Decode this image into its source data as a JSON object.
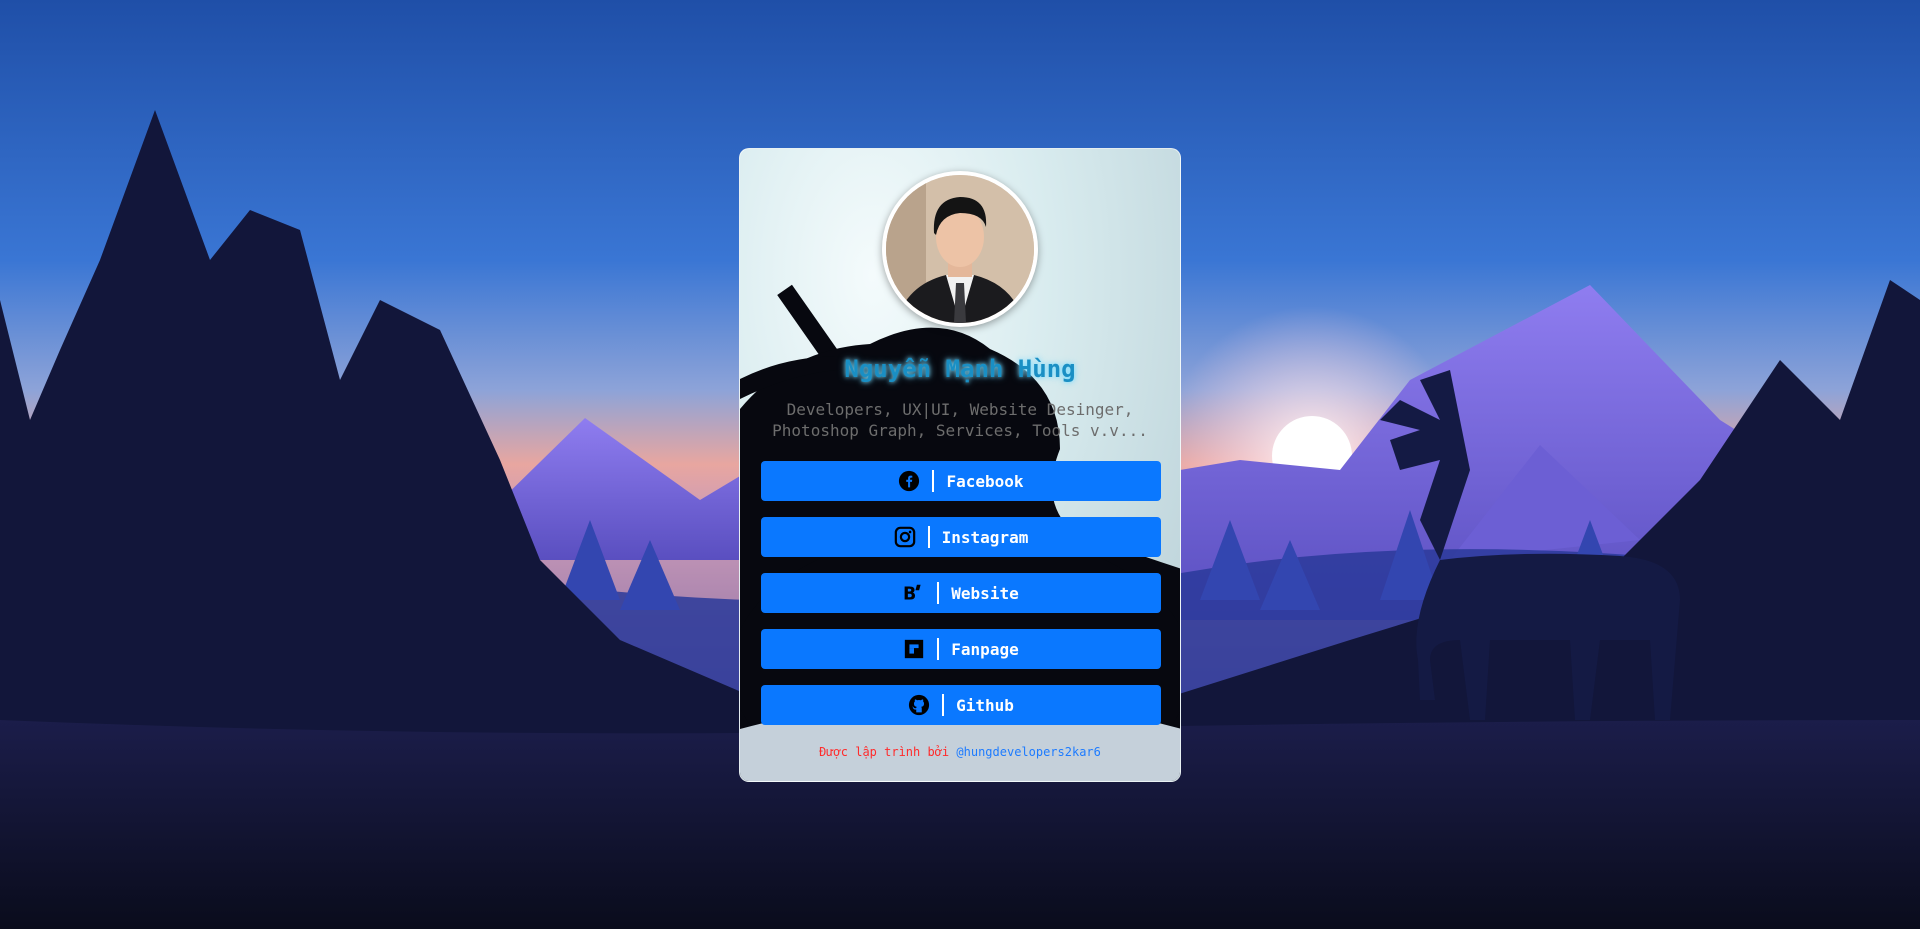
{
  "profile": {
    "name": "Nguyễn Mạnh Hùng",
    "bio_line1": "Developers, UX|UI, Website Desinger,",
    "bio_line2": "Photoshop Graph, Services, Tools v.v..."
  },
  "links": [
    {
      "label": "Facebook",
      "icon": "facebook-icon"
    },
    {
      "label": "Instagram",
      "icon": "instagram-icon"
    },
    {
      "label": "Website",
      "icon": "behance-icon"
    },
    {
      "label": "Fanpage",
      "icon": "flipboard-icon"
    },
    {
      "label": "Github",
      "icon": "github-icon"
    }
  ],
  "footer": {
    "by_text": "Được lập trình bởi",
    "handle": "@hungdevelopers2kar6"
  },
  "colors": {
    "button": "#0a78ff",
    "name": "#1a8fc4",
    "footer_by": "#ff2b2b",
    "footer_handle": "#1d7bff"
  }
}
